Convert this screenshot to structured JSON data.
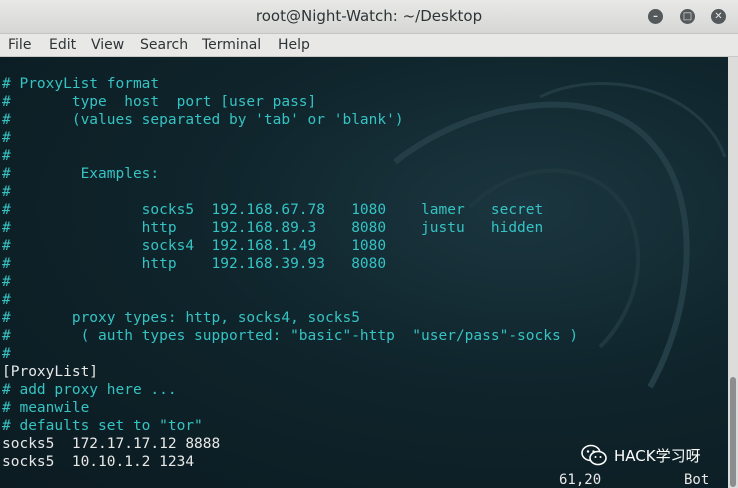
{
  "window": {
    "title": "root@Night-Watch: ~/Desktop",
    "minimize_icon": "minimize-icon",
    "maximize_icon": "maximize-icon",
    "close_icon": "close-icon"
  },
  "menu": [
    "File",
    "Edit",
    "View",
    "Search",
    "Terminal",
    "Help"
  ],
  "terminal": {
    "lines": [
      {
        "text": "# ProxyList format",
        "color": "cyan"
      },
      {
        "text": "#       type  host  port [user pass]",
        "color": "cyan"
      },
      {
        "text": "#       (values separated by 'tab' or 'blank')",
        "color": "cyan"
      },
      {
        "text": "#",
        "color": "cyan"
      },
      {
        "text": "#",
        "color": "cyan"
      },
      {
        "text": "#        Examples:",
        "color": "cyan"
      },
      {
        "text": "#",
        "color": "cyan"
      },
      {
        "text": "#               socks5  192.168.67.78   1080    lamer   secret",
        "color": "cyan"
      },
      {
        "text": "#               http    192.168.89.3    8080    justu   hidden",
        "color": "cyan"
      },
      {
        "text": "#               socks4  192.168.1.49    1080",
        "color": "cyan"
      },
      {
        "text": "#               http    192.168.39.93   8080",
        "color": "cyan"
      },
      {
        "text": "#",
        "color": "cyan"
      },
      {
        "text": "#",
        "color": "cyan"
      },
      {
        "text": "#       proxy types: http, socks4, socks5",
        "color": "cyan"
      },
      {
        "text": "#        ( auth types supported: \"basic\"-http  \"user/pass\"-socks )",
        "color": "cyan"
      },
      {
        "text": "#",
        "color": "cyan"
      },
      {
        "text": "[ProxyList]",
        "color": "white"
      },
      {
        "text": "# add proxy here ...",
        "color": "cyan"
      },
      {
        "text": "# meanwile",
        "color": "cyan"
      },
      {
        "text": "# defaults set to \"tor\"",
        "color": "cyan"
      },
      {
        "text": "socks5  172.17.17.12 8888",
        "color": "white"
      },
      {
        "text": "socks5  10.10.1.2 1234",
        "color": "white"
      }
    ],
    "cursor_position": "61,20",
    "scroll_position": "Bot"
  },
  "watermark": {
    "icon": "wechat-icon",
    "text": "HACK学习呀"
  },
  "colors": {
    "terminal_bg": "#0d1e24",
    "comment_text": "#35c3c3",
    "plain_text": "#e8e8e8",
    "titlebar_bg": "#e0e0df"
  }
}
